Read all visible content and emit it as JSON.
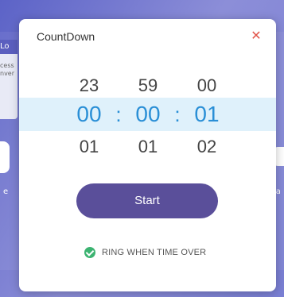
{
  "background": {
    "left_card_header": "Lo",
    "left_card_lines": [
      "cess",
      "nver"
    ],
    "left_label": "e",
    "right_label": "ia"
  },
  "dialog": {
    "title": "CountDown",
    "close_icon": "close-icon"
  },
  "picker": {
    "above": [
      "23",
      "59",
      "00"
    ],
    "selected": [
      "00",
      "00",
      "01"
    ],
    "below": [
      "01",
      "01",
      "02"
    ],
    "separator": ":"
  },
  "actions": {
    "start_label": "Start"
  },
  "options": {
    "ring_label": "RING WHEN TIME OVER",
    "ring_checked": true
  },
  "colors": {
    "accent": "#2a8fd6",
    "start_button": "#5a4f9a",
    "check": "#3cb371",
    "close": "#e2574c"
  }
}
